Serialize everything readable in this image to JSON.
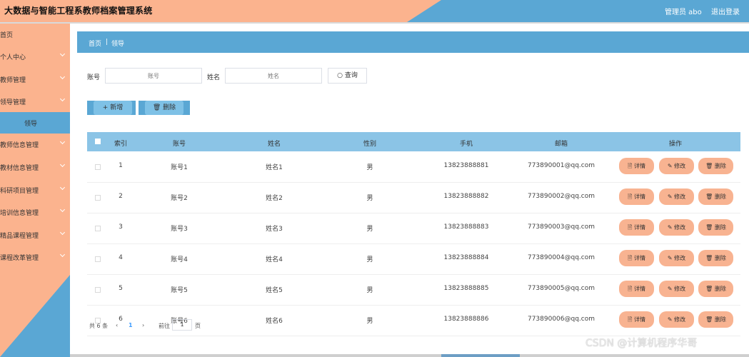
{
  "header": {
    "title": "大数据与智能工程系教师档案管理系统",
    "admin_text": "管理员 abo",
    "logout_label": "退出登录"
  },
  "sidebar": {
    "items": [
      {
        "label": "首页",
        "chevron": false
      },
      {
        "label": "个人中心",
        "chevron": true
      },
      {
        "label": "教师管理",
        "chevron": true
      },
      {
        "label": "领导管理",
        "chevron": true
      },
      {
        "label": "领导",
        "chevron": false,
        "active": true
      },
      {
        "label": "教师信息管理",
        "chevron": true
      },
      {
        "label": "教材信息管理",
        "chevron": true
      },
      {
        "label": "科研项目管理",
        "chevron": true
      },
      {
        "label": "培训信息管理",
        "chevron": true
      },
      {
        "label": "精品课程管理",
        "chevron": true
      },
      {
        "label": "课程改革管理",
        "chevron": true
      }
    ]
  },
  "breadcrumb": {
    "home": "首页",
    "separator": "|",
    "current": "领导"
  },
  "filters": {
    "account_label": "账号",
    "account_placeholder": "账号",
    "name_label": "姓名",
    "name_placeholder": "姓名",
    "search_label": "○ 查询"
  },
  "actions": {
    "add_label": "+ 新增",
    "delete_label": "🗑 删除"
  },
  "table": {
    "columns": [
      "索引",
      "账号",
      "姓名",
      "性别",
      "手机",
      "邮箱",
      "操作"
    ],
    "rows": [
      {
        "index": "1",
        "account": "账号1",
        "name": "姓名1",
        "gender": "男",
        "phone": "13823888881",
        "email": "773890001@qq.com"
      },
      {
        "index": "2",
        "account": "账号2",
        "name": "姓名2",
        "gender": "男",
        "phone": "13823888882",
        "email": "773890002@qq.com"
      },
      {
        "index": "3",
        "account": "账号3",
        "name": "姓名3",
        "gender": "男",
        "phone": "13823888883",
        "email": "773890003@qq.com"
      },
      {
        "index": "4",
        "account": "账号4",
        "name": "姓名4",
        "gender": "男",
        "phone": "13823888884",
        "email": "773890004@qq.com"
      },
      {
        "index": "5",
        "account": "账号5",
        "name": "姓名5",
        "gender": "男",
        "phone": "13823888885",
        "email": "773890005@qq.com"
      },
      {
        "index": "6",
        "account": "账号6",
        "name": "姓名6",
        "gender": "男",
        "phone": "13823888886",
        "email": "773890006@qq.com"
      }
    ],
    "row_ops": [
      "🗎 详情",
      "✎ 修改",
      "🗑 删除"
    ]
  },
  "pagination": {
    "total_text": "共 6 条",
    "prev": "‹",
    "current_page": "1",
    "next": "›",
    "goto_label": "前往",
    "goto_value": "1",
    "page_suffix": "页"
  },
  "watermark": "CSDN @计算机程序华哥",
  "colors": {
    "accent_blue": "#5aa7d4",
    "accent_orange": "#fbb38e",
    "header_row": "#8bc4e6",
    "op_button": "#f8b391"
  }
}
